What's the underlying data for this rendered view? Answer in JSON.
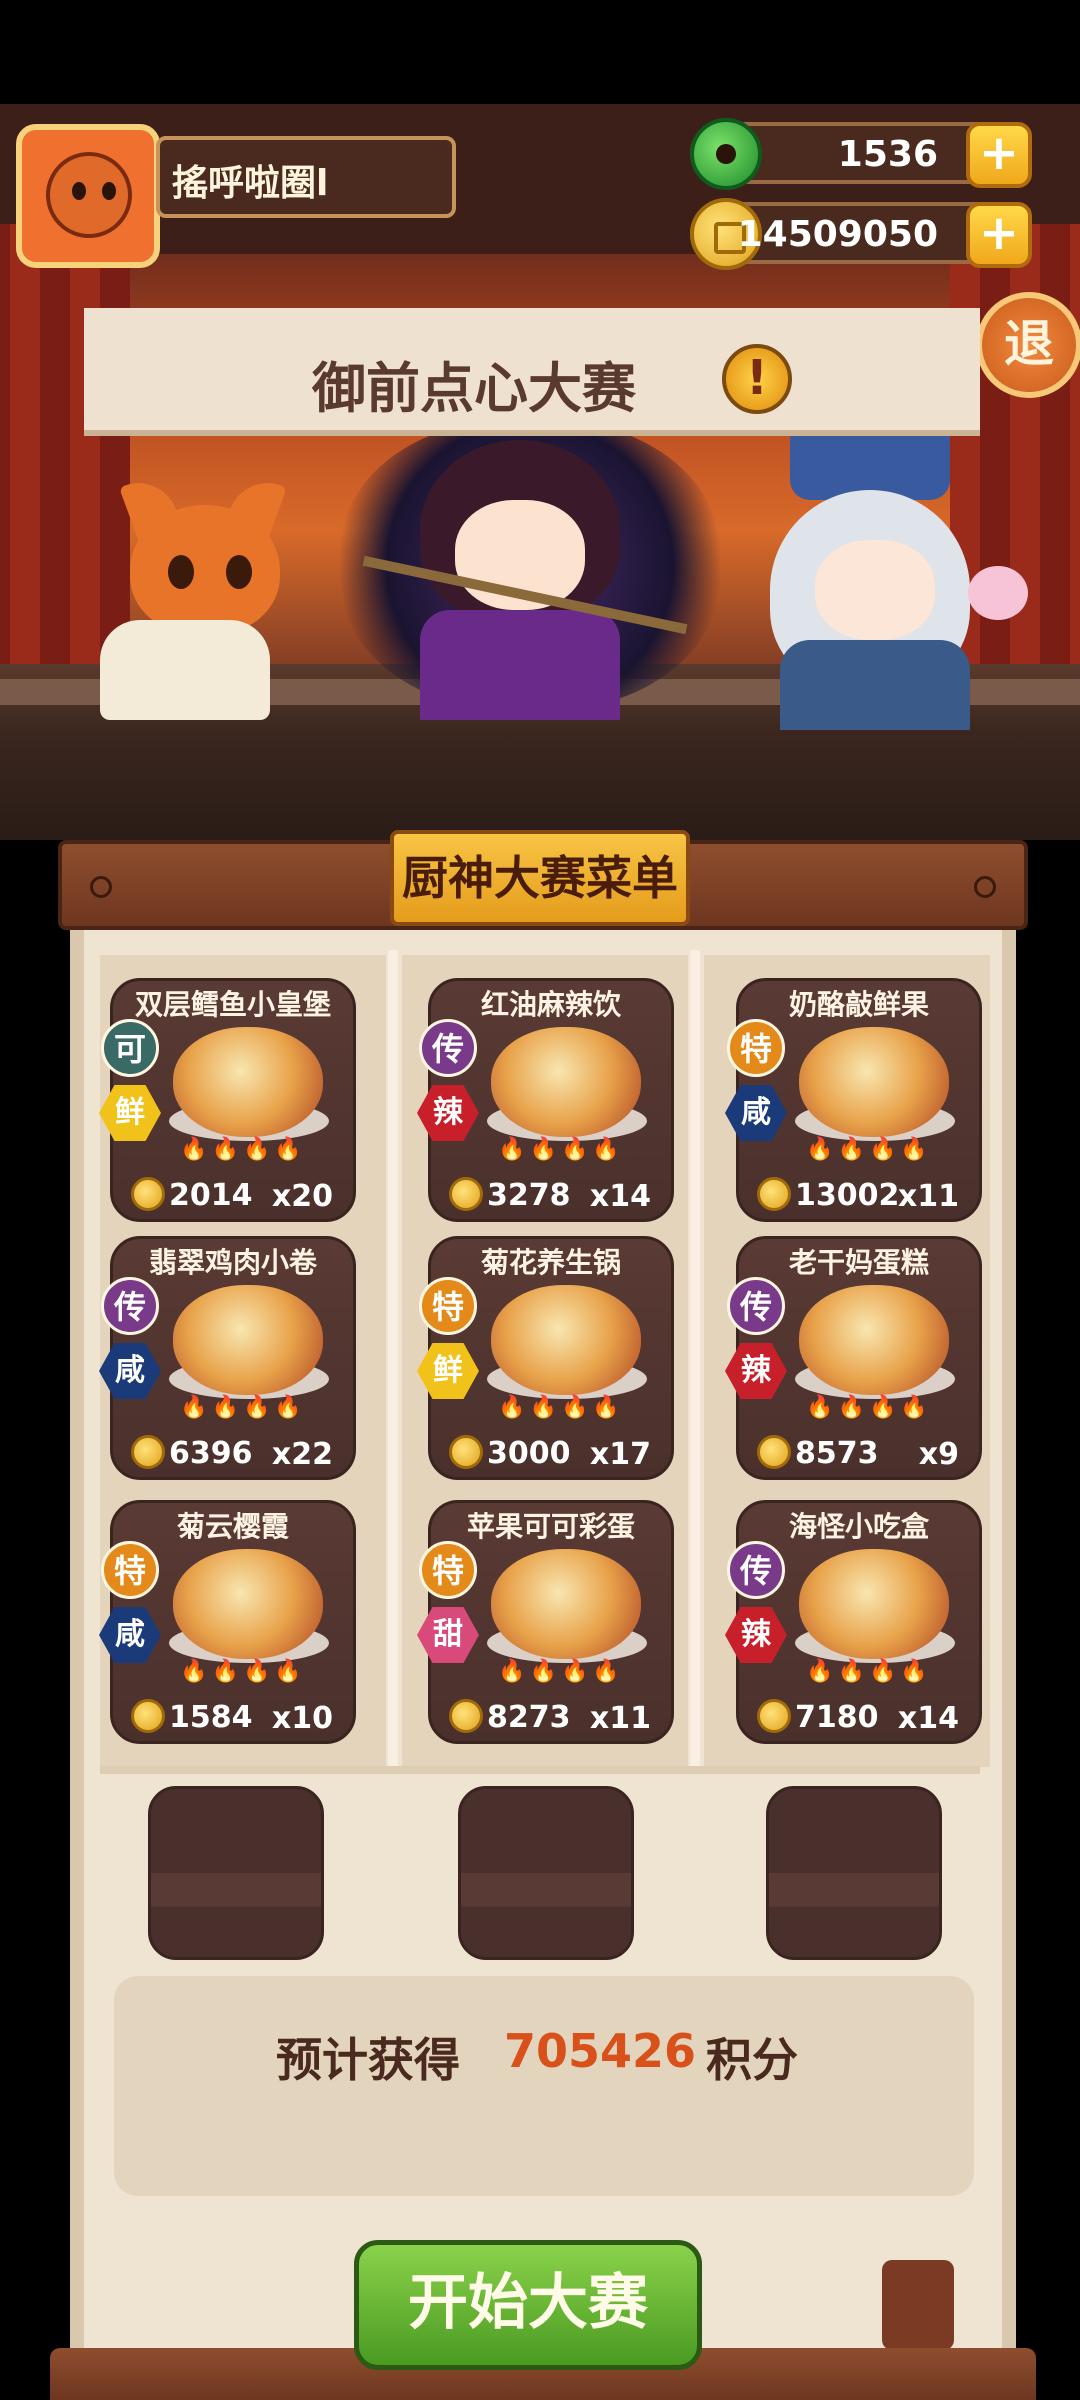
{
  "player": {
    "name": "搖呼啦圈l"
  },
  "resources": [
    {
      "name": "jade",
      "value": "1536",
      "add_label": "+"
    },
    {
      "name": "coins",
      "value": "14509050",
      "add_label": "+"
    }
  ],
  "exit_label": "退",
  "event": {
    "title": "御前点心大赛",
    "alert": "!"
  },
  "menu": {
    "title": "厨神大赛菜单",
    "dishes": [
      {
        "name": "双层鳕鱼小皇堡",
        "grade": "可",
        "flavor": "鲜",
        "price": "2014",
        "qty": "x20"
      },
      {
        "name": "红油麻辣饮",
        "grade": "传",
        "flavor": "辣",
        "price": "3278",
        "qty": "x14"
      },
      {
        "name": "奶酪敲鲜果",
        "grade": "特",
        "flavor": "咸",
        "price": "13002",
        "qty": "x11"
      },
      {
        "name": "翡翠鸡肉小卷",
        "grade": "传",
        "flavor": "咸",
        "price": "6396",
        "qty": "x22"
      },
      {
        "name": "菊花养生锅",
        "grade": "特",
        "flavor": "鲜",
        "price": "3000",
        "qty": "x17"
      },
      {
        "name": "老干妈蛋糕",
        "grade": "传",
        "flavor": "辣",
        "price": "8573",
        "qty": "x9"
      },
      {
        "name": "菊云樱霞",
        "grade": "特",
        "flavor": "咸",
        "price": "1584",
        "qty": "x10"
      },
      {
        "name": "苹果可可彩蛋",
        "grade": "特",
        "flavor": "甜",
        "price": "8273",
        "qty": "x11"
      },
      {
        "name": "海怪小吃盒",
        "grade": "传",
        "flavor": "辣",
        "price": "7180",
        "qty": "x14"
      }
    ],
    "flames": "🔥🔥🔥🔥"
  },
  "score": {
    "label": "预计获得",
    "value": "705426",
    "unit": "积分"
  },
  "start_label": "开始大赛",
  "colors": {
    "accent_orange": "#d8501a",
    "start_green": "#4a9a22",
    "board": "#efe3d1"
  }
}
